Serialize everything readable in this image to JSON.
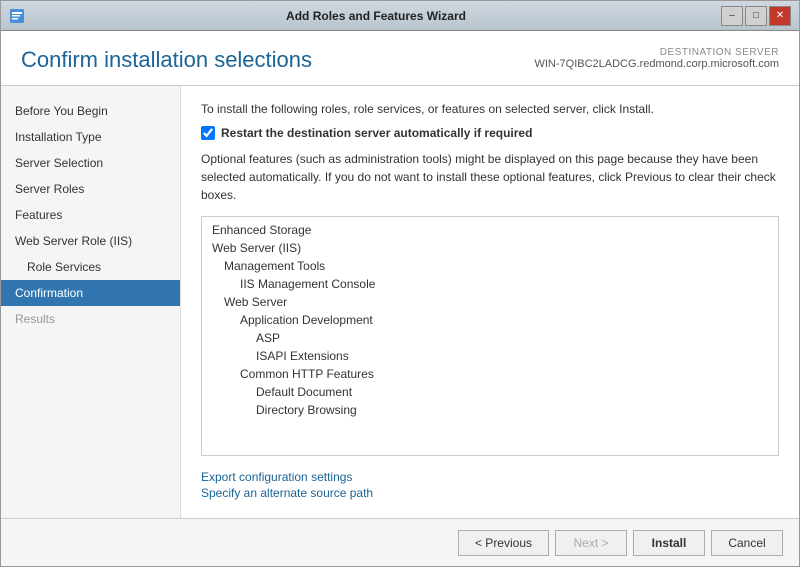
{
  "window": {
    "title": "Add Roles and Features Wizard",
    "icon": "wizard-icon",
    "controls": {
      "minimize": "–",
      "maximize": "□",
      "close": "✕"
    }
  },
  "header": {
    "title": "Confirm installation selections",
    "destination_label": "DESTINATION SERVER",
    "destination_name": "WIN-7QIBC2LADCG.redmond.corp.microsoft.com"
  },
  "sidebar": {
    "items": [
      {
        "label": "Before You Begin",
        "active": false,
        "sub": false,
        "disabled": false
      },
      {
        "label": "Installation Type",
        "active": false,
        "sub": false,
        "disabled": false
      },
      {
        "label": "Server Selection",
        "active": false,
        "sub": false,
        "disabled": false
      },
      {
        "label": "Server Roles",
        "active": false,
        "sub": false,
        "disabled": false
      },
      {
        "label": "Features",
        "active": false,
        "sub": false,
        "disabled": false
      },
      {
        "label": "Web Server Role (IIS)",
        "active": false,
        "sub": false,
        "disabled": false
      },
      {
        "label": "Role Services",
        "active": false,
        "sub": true,
        "disabled": false
      },
      {
        "label": "Confirmation",
        "active": true,
        "sub": false,
        "disabled": false
      },
      {
        "label": "Results",
        "active": false,
        "sub": false,
        "disabled": true
      }
    ]
  },
  "main": {
    "instruction": "To install the following roles, role services, or features on selected server, click Install.",
    "checkbox_label": "Restart the destination server automatically if required",
    "checkbox_checked": true,
    "optional_text": "Optional features (such as administration tools) might be displayed on this page because they have been selected automatically. If you do not want to install these optional features, click Previous to clear their check boxes.",
    "features": [
      {
        "label": "Enhanced Storage",
        "indent": 0
      },
      {
        "label": "Web Server (IIS)",
        "indent": 0
      },
      {
        "label": "Management Tools",
        "indent": 1
      },
      {
        "label": "IIS Management Console",
        "indent": 2
      },
      {
        "label": "Web Server",
        "indent": 1
      },
      {
        "label": "Application Development",
        "indent": 2
      },
      {
        "label": "ASP",
        "indent": 3
      },
      {
        "label": "ISAPI Extensions",
        "indent": 3
      },
      {
        "label": "Common HTTP Features",
        "indent": 2
      },
      {
        "label": "Default Document",
        "indent": 3
      },
      {
        "label": "Directory Browsing",
        "indent": 3
      }
    ],
    "links": [
      {
        "label": "Export configuration settings"
      },
      {
        "label": "Specify an alternate source path"
      }
    ]
  },
  "footer": {
    "previous_label": "< Previous",
    "next_label": "Next >",
    "install_label": "Install",
    "cancel_label": "Cancel"
  }
}
